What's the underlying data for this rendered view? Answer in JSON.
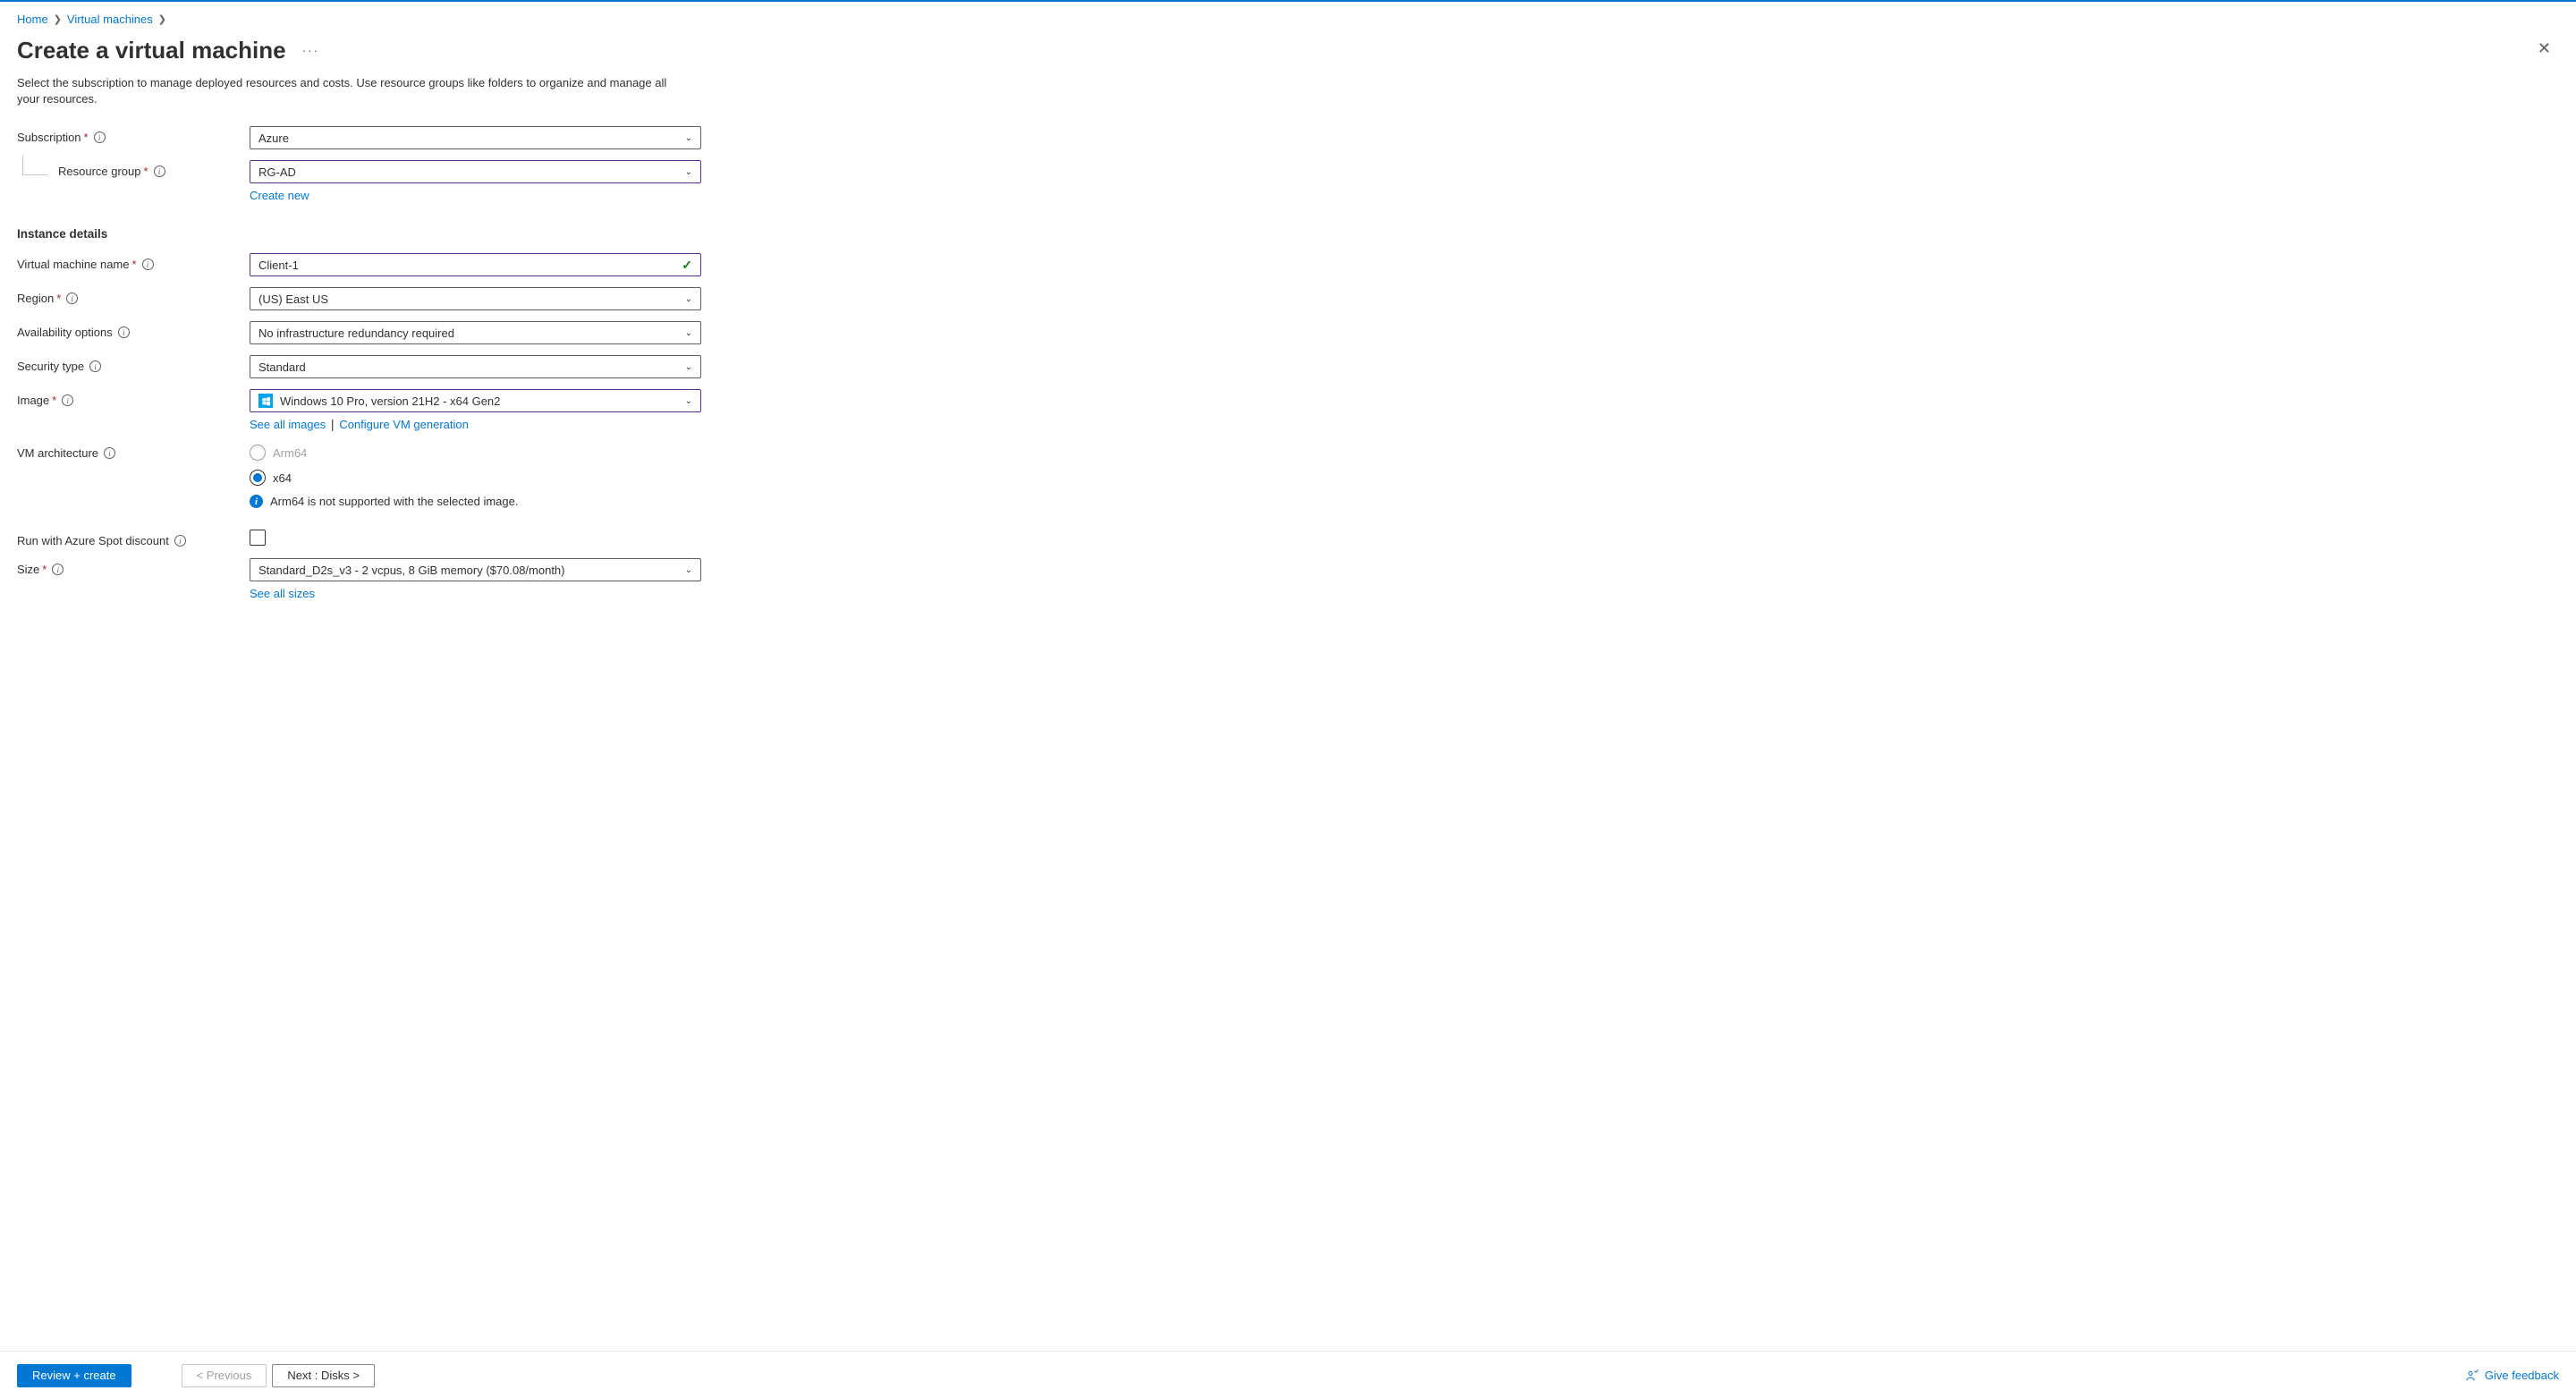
{
  "breadcrumb": {
    "home": "Home",
    "vms": "Virtual machines"
  },
  "page_title": "Create a virtual machine",
  "description": "Select the subscription to manage deployed resources and costs. Use resource groups like folders to organize and manage all your resources.",
  "fields": {
    "subscription": {
      "label": "Subscription",
      "value": "Azure"
    },
    "resource_group": {
      "label": "Resource group",
      "value": "RG-AD",
      "create_new": "Create new"
    },
    "instance_details_title": "Instance details",
    "vm_name": {
      "label": "Virtual machine name",
      "value": "Client-1"
    },
    "region": {
      "label": "Region",
      "value": "(US) East US"
    },
    "availability": {
      "label": "Availability options",
      "value": "No infrastructure redundancy required"
    },
    "security": {
      "label": "Security type",
      "value": "Standard"
    },
    "image": {
      "label": "Image",
      "value": "Windows 10 Pro, version 21H2 - x64 Gen2",
      "see_all": "See all images",
      "configure": "Configure VM generation"
    },
    "arch": {
      "label": "VM architecture",
      "arm64": "Arm64",
      "x64": "x64",
      "info": "Arm64 is not supported with the selected image."
    },
    "spot": {
      "label": "Run with Azure Spot discount"
    },
    "size": {
      "label": "Size",
      "value": "Standard_D2s_v3 - 2 vcpus, 8 GiB memory ($70.08/month)",
      "see_all": "See all sizes"
    }
  },
  "footer": {
    "review": "Review + create",
    "previous": "< Previous",
    "next": "Next : Disks >",
    "feedback": "Give feedback"
  }
}
